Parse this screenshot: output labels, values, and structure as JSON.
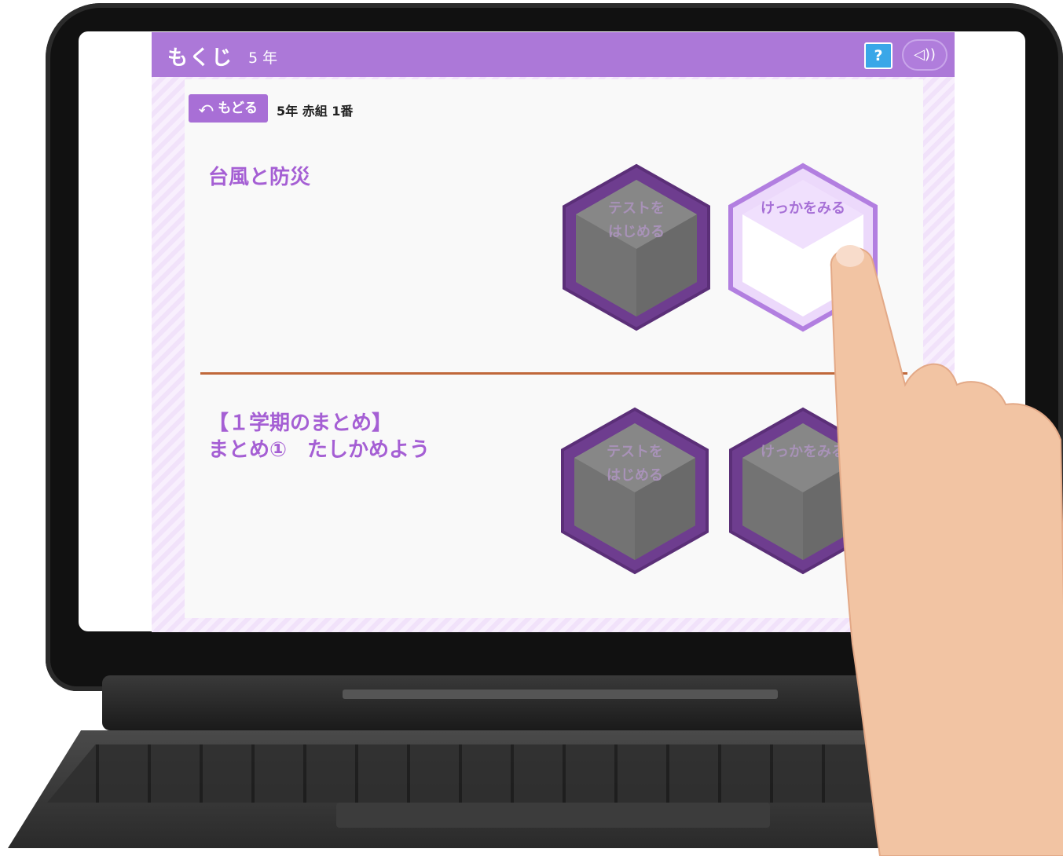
{
  "header": {
    "title": "もくじ",
    "grade": "5 年",
    "help_label": "?",
    "sound_label": "◁))"
  },
  "nav": {
    "back_label": "⤺ もどる",
    "student": "5年 赤組 1番"
  },
  "units": [
    {
      "title": "台風と防災",
      "start_label": "テストを\nはじめる",
      "result_label": "けっかをみる"
    },
    {
      "title": "【１学期のまとめ】\nまとめ①　たしかめよう",
      "start_label": "テストを\nはじめる",
      "result_label": "けっかをみる"
    }
  ],
  "colors": {
    "header": "#ac78d8",
    "accent_text": "#a55fd4",
    "divider": "#c0683a",
    "hex_dim_outline": "#6b3c8c",
    "hex_active_outline": "#b27fe0"
  }
}
